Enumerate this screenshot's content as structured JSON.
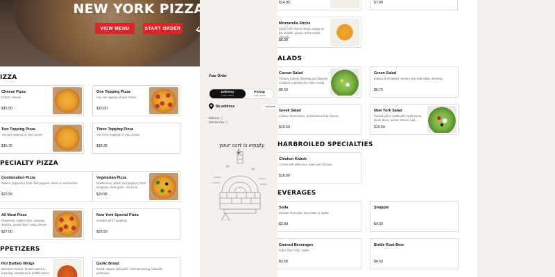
{
  "hero": {
    "title": "NEW YORK PIZZA",
    "view_menu": "VIEW MENU",
    "start_order": "START ORDER"
  },
  "left_sections": [
    {
      "title": "IZZA",
      "items": [
        {
          "name": "Cheese Pizza",
          "desc": "Classic cheese.",
          "price": "$15.50"
        },
        {
          "name": "One Topping Pizza",
          "desc": "Any one topping of your choice",
          "price": "$15.00"
        },
        {
          "name": "Two Topping Pizza",
          "desc": "Any two toppings of your choice",
          "price": "$16.75"
        },
        {
          "name": "Three Topping Pizza",
          "desc": "Any three toppings of your choice",
          "price": "$18.35"
        }
      ]
    },
    {
      "title": "PECIALTY PIZZA",
      "items": [
        {
          "name": "Combination Pizza",
          "desc": "Salami, pepperoni, ham, bell peppers, olives & mushrooms",
          "price": "$22.00"
        },
        {
          "name": "Vegetarian Pizza",
          "desc": "Mushrooms, olives, bell peppers, fresh tomatoes, fresh garlic, onions &...",
          "price": "$20.95"
        },
        {
          "name": "All Meat Pizza",
          "desc": "Pepperoni, salami, ham, sausage, linguica, ground beef, extra cheese.",
          "price": "$27.00"
        },
        {
          "name": "New York Special Pizza",
          "desc": "Includes all 17 toppings.",
          "price": "$29.50"
        }
      ]
    },
    {
      "title": "PPETIZERS",
      "items": [
        {
          "name": "Hot Buffalo Wings",
          "desc": "Boneless chicken breast coated in breading, smothered in buffalo sauce.",
          "price": ""
        },
        {
          "name": "Garlic Bread",
          "desc": "Bread, topped with garlic, herb seasoning, baked to perfection.",
          "price": ""
        }
      ]
    }
  ],
  "cart": {
    "title": "Your Order",
    "delivery_label": "Delivery",
    "delivery_sub": "Order ahead",
    "pickup_label": "Pickup",
    "pickup_sub": "Order ahead",
    "address": "No address",
    "add_address": "Add addr",
    "delivery_fee": "Delivery ⓘ",
    "service_fee": "Service Fee ⓘ",
    "empty": "your cart is empty"
  },
  "right_top": [
    {
      "name": "",
      "desc": "",
      "price": "$14.99"
    },
    {
      "name": "",
      "desc": "",
      "price": "$7.99"
    },
    {
      "name": "Mozzarella Sticks",
      "desc": "Deep fried cheese sticks. Crispy on the outside, gooey on the inside. Virtually...",
      "price": "$8.99"
    }
  ],
  "right_sections": [
    {
      "title": "ALADS",
      "items": [
        {
          "name": "Caesar Salad",
          "desc": "Creamy Caesar dressing and flavorful croutons to please the entire crowd.",
          "price": "$8.50"
        },
        {
          "name": "Green Salad",
          "desc": "Lettuce & tomatoes. Served only with Italian dressing.",
          "price": "$6.75"
        },
        {
          "name": "Greek Salad",
          "desc": "Lettuce, black olives, artichokes & feta cheese.",
          "price": "$10.50"
        },
        {
          "name": "New York Salad",
          "desc": "Tossed green salad with mushrooms, black olives, lemon, onions, bell...",
          "price": "$10.50"
        }
      ]
    },
    {
      "title": "HARBROILED SPECIALTIES",
      "items": [
        {
          "name": "Chicken Kabob",
          "desc": "Comes with white rice, naan and chutney.",
          "price": "$18.99"
        }
      ]
    },
    {
      "title": "EVERAGES",
      "items": [
        {
          "name": "Soda",
          "desc": "Choose from coke, Diet Coke or Sprite",
          "price": "$3.50"
        },
        {
          "name": "Snapple",
          "desc": "",
          "price": "$4.00"
        },
        {
          "name": "Canned Beverages",
          "desc": "Coke, Diet Coke, Sprite",
          "price": "$3.50"
        },
        {
          "name": "Bottle Root Beer",
          "desc": "",
          "price": "$4.50"
        }
      ]
    }
  ]
}
